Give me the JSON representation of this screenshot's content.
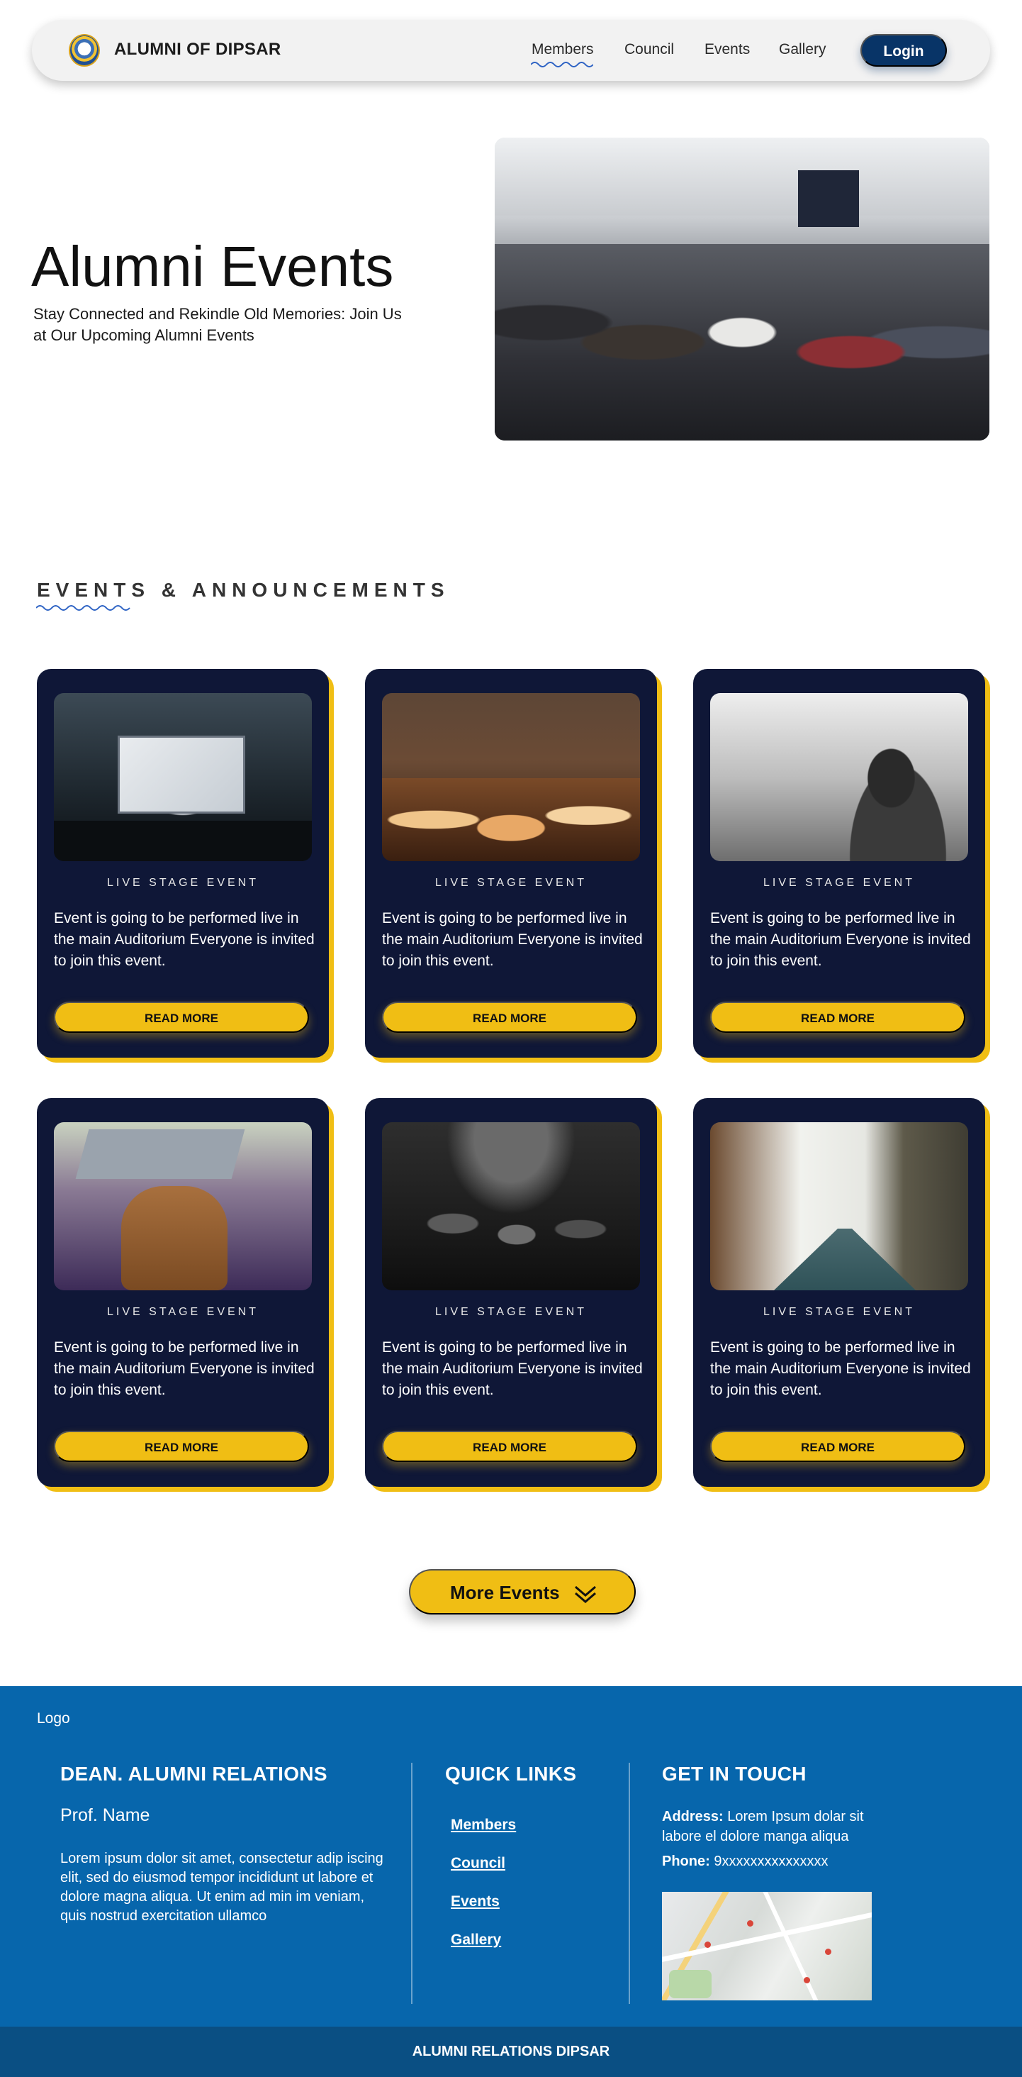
{
  "nav": {
    "brand": "ALUMNI OF DIPSAR",
    "links": [
      "Members",
      "Council",
      "Events",
      "Gallery"
    ],
    "active_link": "Members",
    "login_label": "Login"
  },
  "hero": {
    "title": "Alumni Events",
    "subtitle": "Stay Connected and Rekindle Old Memories: Join Us at Our Upcoming Alumni Events"
  },
  "events_section": {
    "heading": "EVENTS & ANNOUNCEMENTS",
    "cards": [
      {
        "kicker": "LIVE STAGE EVENT",
        "text": "Event is going to be performed live in the main Auditorium Everyone is invited to join this event.",
        "button": "READ MORE"
      },
      {
        "kicker": "LIVE STAGE EVENT",
        "text": "Event is going to be performed live in the main Auditorium Everyone is invited to join this event.",
        "button": "READ MORE"
      },
      {
        "kicker": "LIVE STAGE EVENT",
        "text": "Event is going to be performed live in the main Auditorium Everyone is invited to join this event.",
        "button": "READ MORE"
      },
      {
        "kicker": "LIVE STAGE EVENT",
        "text": "Event is going to be performed live in the main Auditorium Everyone is invited to join this event.",
        "button": "READ MORE"
      },
      {
        "kicker": "LIVE STAGE EVENT",
        "text": "Event is going to be performed live in the main Auditorium Everyone is invited to join this event.",
        "button": "READ MORE"
      },
      {
        "kicker": "LIVE STAGE EVENT",
        "text": "Event is going to be performed live in the main Auditorium Everyone is invited to join this event.",
        "button": "READ MORE"
      }
    ],
    "more_label": "More Events"
  },
  "footer": {
    "logo": "Logo",
    "dean_title": "DEAN. ALUMNI RELATIONS",
    "dean_name": "Prof. Name",
    "dean_text": "Lorem ipsum dolor sit amet, consectetur adip iscing elit, sed do eiusmod tempor incididunt ut labore et dolore magna aliqua. Ut enim ad min im veniam, quis nostrud exercitation ullamco",
    "quick_links_title": "QUICK LINKS",
    "quick_links": [
      "Members",
      "Council",
      "Events",
      "Gallery"
    ],
    "contact_title": "GET IN TOUCH",
    "address_label": "Address:",
    "address_value": "Lorem Ipsum dolar sit labore el dolore manga aliqua",
    "phone_label": "Phone:",
    "phone_value": "9xxxxxxxxxxxxxxx",
    "bottom_text": "ALUMNI RELATIONS DIPSAR"
  },
  "colors": {
    "nav_bg": "#f2f2f2",
    "login_bg": "#083467",
    "card_bg": "#0f1737",
    "accent_yellow": "#f0be14",
    "footer_bg": "#0766ac",
    "bottom_bar_bg": "#0a4f83",
    "squiggle": "#2e63c4"
  },
  "icons": {
    "nav_logo": "college-emblem-icon",
    "more_events": "double-chevron-down-icon"
  }
}
